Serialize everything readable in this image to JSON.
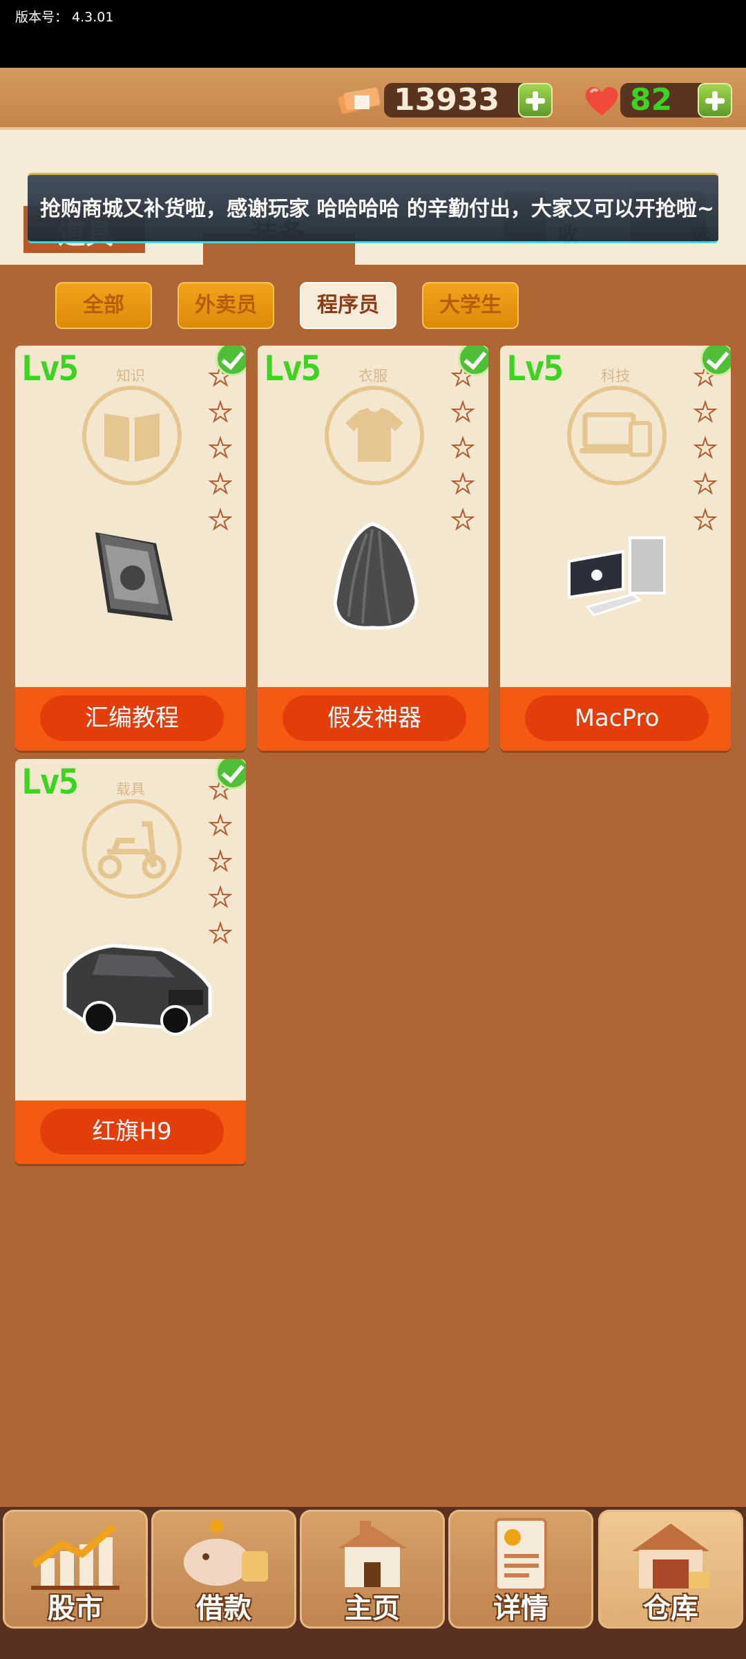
{
  "status": {
    "version": "版本号：  4.3.01"
  },
  "resources": {
    "money": "13933",
    "hearts": "82"
  },
  "main_tabs": [
    "道具",
    "装备",
    "收",
    "选"
  ],
  "banner": {
    "text": "抢购商城又补货啦，感谢玩家 哈哈哈哈 的辛勤付出，大家又可以开抢啦~"
  },
  "filters": [
    "全部",
    "外卖员",
    "程序员",
    "大学生"
  ],
  "selected_filter": "程序员",
  "cards": [
    {
      "level": "Lv5",
      "category": "知识",
      "name": "汇编教程",
      "stars": 0
    },
    {
      "level": "Lv5",
      "category": "衣服",
      "name": "假发神器",
      "stars": 0
    },
    {
      "level": "Lv5",
      "category": "科技",
      "name": "MacPro",
      "stars": 0
    },
    {
      "level": "Lv5",
      "category": "载具",
      "name": "红旗H9",
      "stars": 0
    }
  ],
  "nav": [
    "股市",
    "借款",
    "主页",
    "详情",
    "仓库"
  ],
  "active_nav": "仓库",
  "colors": {
    "background": "#b06535",
    "level": "#3cd420",
    "card_footer": "#f55a12"
  }
}
